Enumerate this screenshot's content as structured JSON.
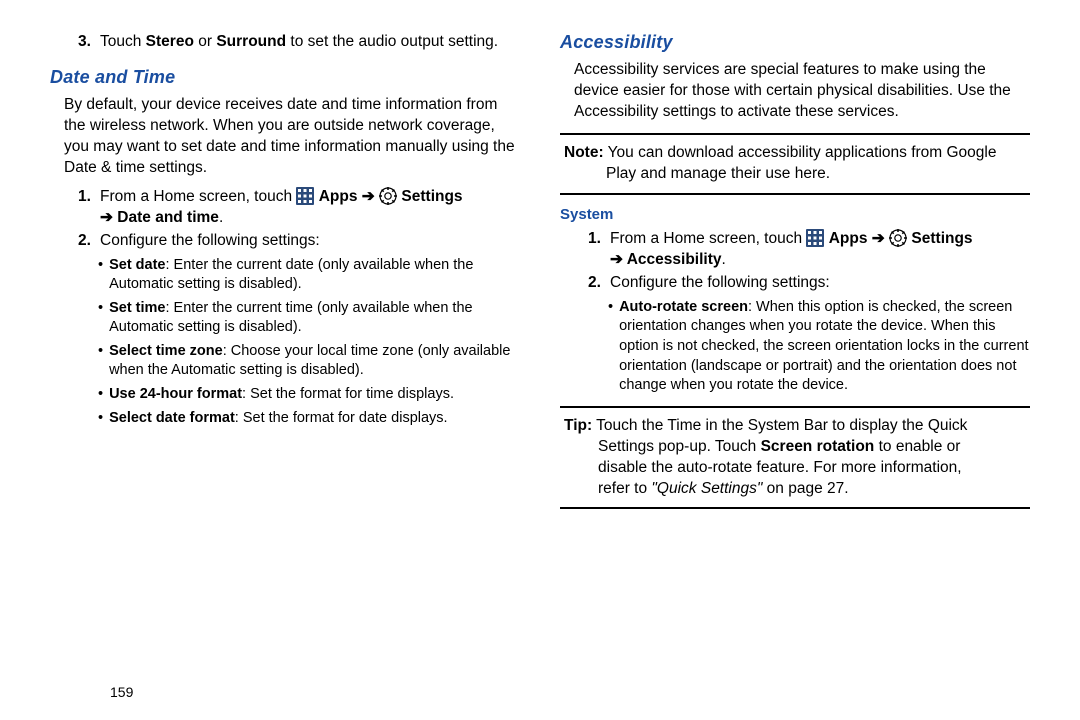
{
  "left": {
    "audio_step_num": "3.",
    "audio_step_pre": "Touch ",
    "audio_step_b1": "Stereo",
    "audio_step_mid": " or ",
    "audio_step_b2": "Surround",
    "audio_step_post": " to set the audio output setting.",
    "h_datetime": "Date and Time",
    "p_datetime": "By default, your device receives date and time information from the wireless network. When you are outside network coverage, you may want to set date and time information manually using the Date & time settings.",
    "s1_num": "1.",
    "s1_pre": "From a Home screen, touch ",
    "s1_apps": "Apps",
    "s1_settings": "Settings",
    "s1_arrow1": " ➔ ",
    "s1_arrow2": " ➔ ",
    "s1_tail": "Date and time",
    "s1_dot": ".",
    "s2_num": "2.",
    "s2_txt": "Configure the following settings:",
    "b1_h": "Set date",
    "b1_t": ": Enter the current date (only available when the Automatic setting is disabled).",
    "b2_h": "Set time",
    "b2_t": ": Enter the current time (only available when the Automatic setting is disabled).",
    "b3_h": "Select time zone",
    "b3_t": ": Choose your local time zone (only available when the Automatic setting is disabled).",
    "b4_h": "Use 24-hour format",
    "b4_t": ": Set the format for time displays.",
    "b5_h": "Select date format",
    "b5_t": ": Set the format for date displays."
  },
  "right": {
    "h_access": "Accessibility",
    "p_access": "Accessibility services are special features to make using the device easier for those with certain physical disabilities. Use the Accessibility settings to activate these services.",
    "note_label": "Note:",
    "note_text_a": " You can download accessibility applications from Google",
    "note_text_b": "Play and manage their use here.",
    "h_system": "System",
    "s1_num": "1.",
    "s1_pre": "From a Home screen, touch ",
    "s1_apps": "Apps",
    "s1_settings": "Settings",
    "s1_arrow1": " ➔ ",
    "s1_arrow2": " ➔ ",
    "s1_tail": "Accessibility",
    "s1_dot": ".",
    "s2_num": "2.",
    "s2_txt": "Configure the following settings:",
    "b1_h": "Auto-rotate screen",
    "b1_t": ": When this option is checked, the screen orientation changes when you rotate the device. When this option is not checked, the screen orientation locks in the current orientation (landscape or portrait) and the orientation does not change when you rotate the device.",
    "tip_label": "Tip:",
    "tip_a": " Touch the Time in the System Bar to display the Quick",
    "tip_b1": "Settings pop-up. Touch ",
    "tip_b1_bold": "Screen rotation",
    "tip_b2": " to enable or",
    "tip_c": "disable the auto-rotate feature. For more information,",
    "tip_d_pre": "refer to ",
    "tip_d_ital": "\"Quick Settings\"",
    "tip_d_post": " on page 27."
  },
  "page_num": "159"
}
